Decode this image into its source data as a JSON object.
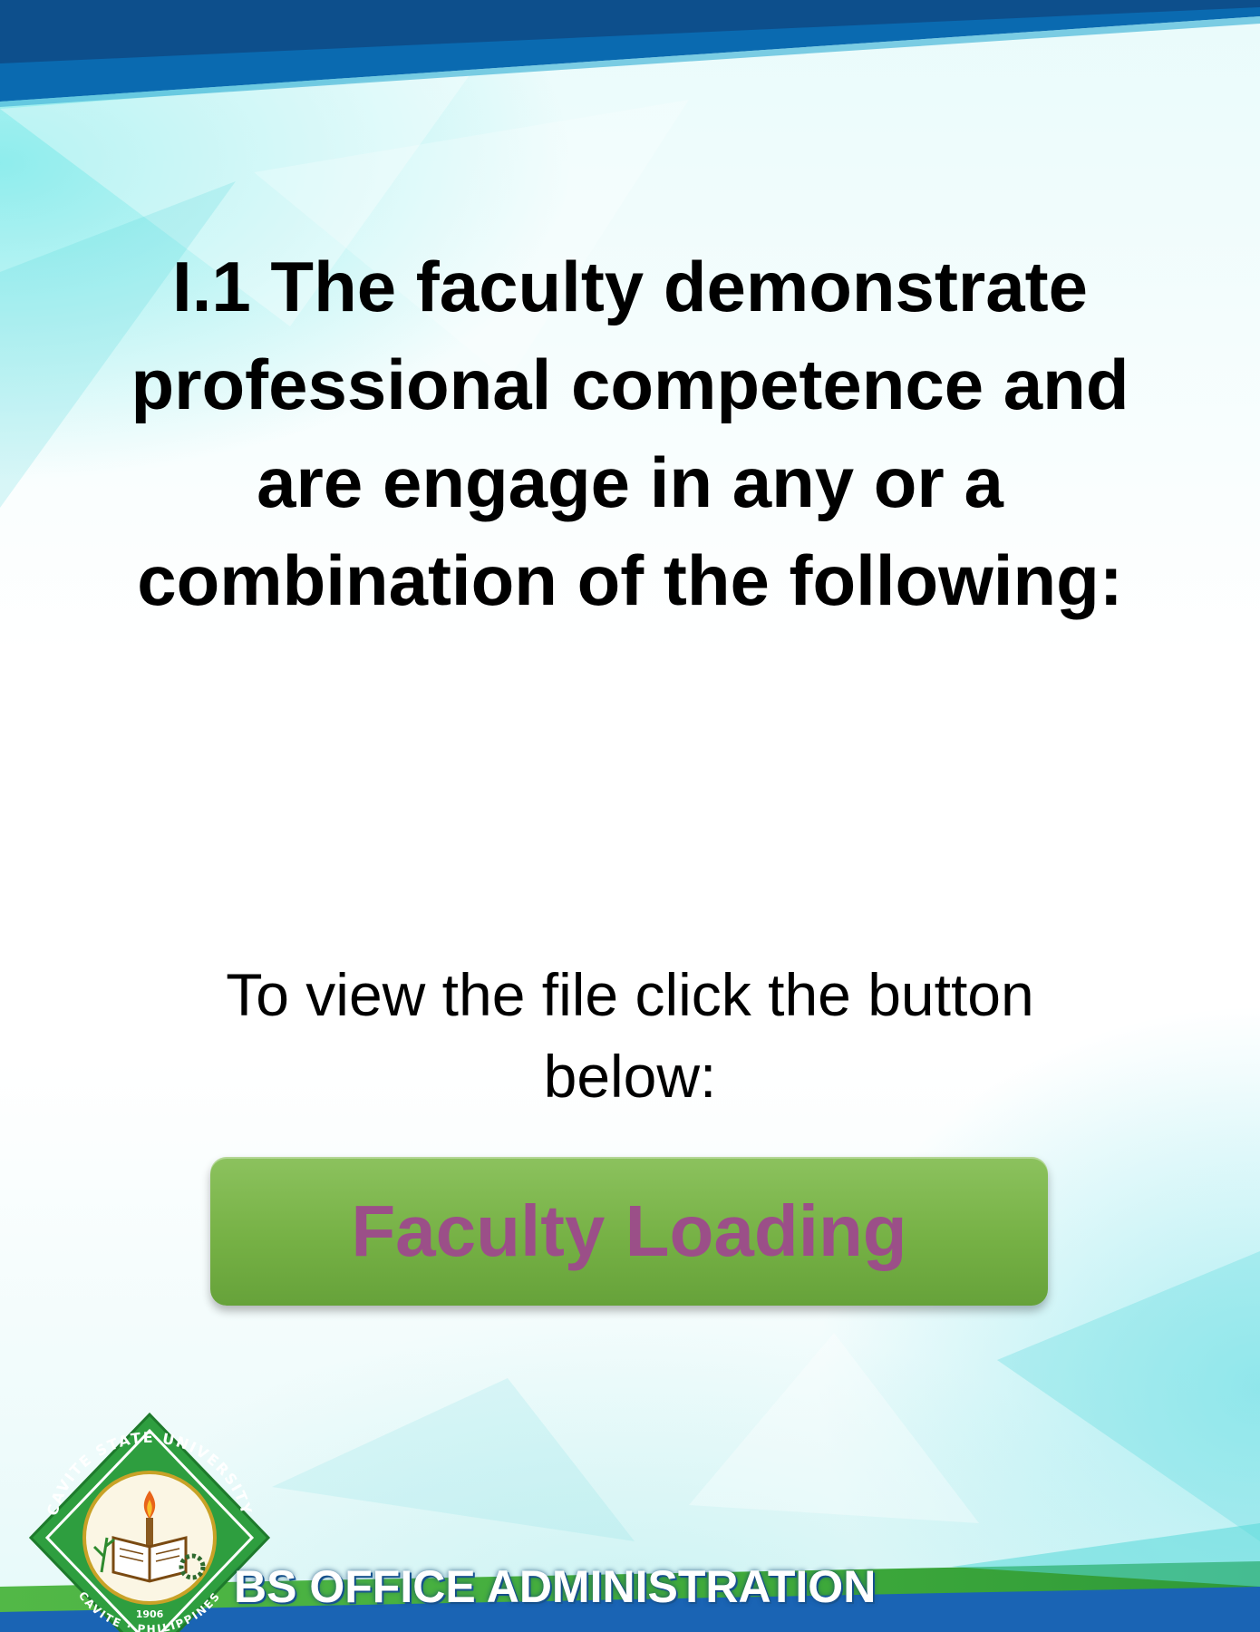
{
  "heading": "I.1 The faculty demonstrate professional competence and are engage in any or a combination of the following:",
  "instruction": "To view the file click the button below:",
  "button": {
    "label": "Faculty Loading"
  },
  "footer": {
    "title": "BS OFFICE ADMINISTRATION"
  },
  "logo": {
    "text_top": "CAVITE STATE UNIVERSITY",
    "text_bottom": "CAVITE · PHILIPPINES",
    "year": "1906"
  },
  "colors": {
    "top_band": "#0a6ab0",
    "bottom_band_green": "#3faa3a",
    "bottom_band_blue": "#1a64b4",
    "button": "#76b145",
    "button_text": "#9b4f88",
    "logo_green": "#2e9e3f"
  }
}
